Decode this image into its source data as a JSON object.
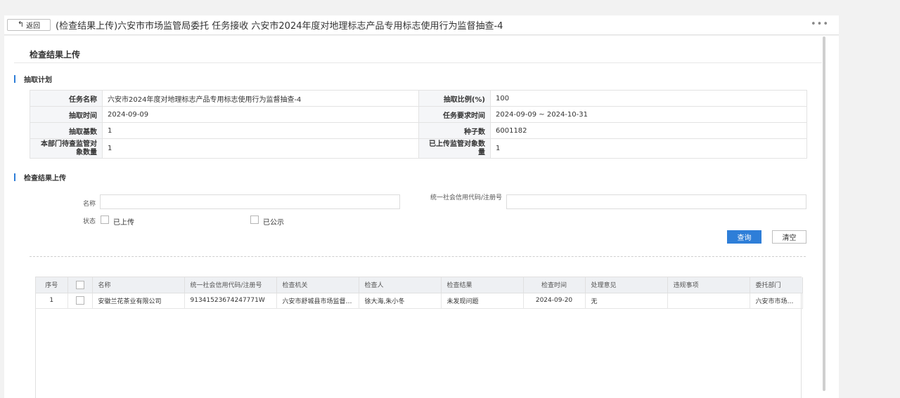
{
  "header": {
    "back_label": "返回",
    "title": "(检查结果上传)六安市市场监管局委托 任务接收 六安市2024年度对地理标志产品专用标志使用行为监督抽查-4"
  },
  "section_title": "检查结果上传",
  "plan": {
    "heading": "抽取计划",
    "rows": [
      {
        "l1": "任务名称",
        "v1": "六安市2024年度对地理标志产品专用标志使用行为监督抽查-4",
        "l2": "抽取比例(%)",
        "v2": "100"
      },
      {
        "l1": "抽取时间",
        "v1": "2024-09-09",
        "l2": "任务要求时间",
        "v2": "2024-09-09 ~ 2024-10-31"
      },
      {
        "l1": "抽取基数",
        "v1": "1",
        "l2": "种子数",
        "v2": "6001182"
      },
      {
        "l1": "本部门待查监管对象数量",
        "v1": "1",
        "l2": "已上传监管对象数量",
        "v2": "1"
      }
    ]
  },
  "upload": {
    "heading": "检查结果上传",
    "name_label": "名称",
    "name_value": "",
    "code_label": "统一社会信用代码/注册号",
    "code_value": "",
    "status_label": "状态",
    "opt_uploaded": "已上传",
    "opt_published": "已公示",
    "query_label": "查询",
    "clear_label": "清空"
  },
  "results": {
    "columns": [
      "序号",
      "",
      "名称",
      "统一社会信用代码/注册号",
      "检查机关",
      "检查人",
      "检查结果",
      "检查时间",
      "处理意见",
      "违规事项",
      "委托部门"
    ],
    "rows": [
      [
        "1",
        "",
        "安徽兰花茶业有限公司",
        "91341523674247771W",
        "六安市舒城县市场监督管理局",
        "徐大海,朱小冬",
        "未发现问题",
        "2024-09-20",
        "无",
        "",
        "六安市市场监管局"
      ]
    ]
  }
}
